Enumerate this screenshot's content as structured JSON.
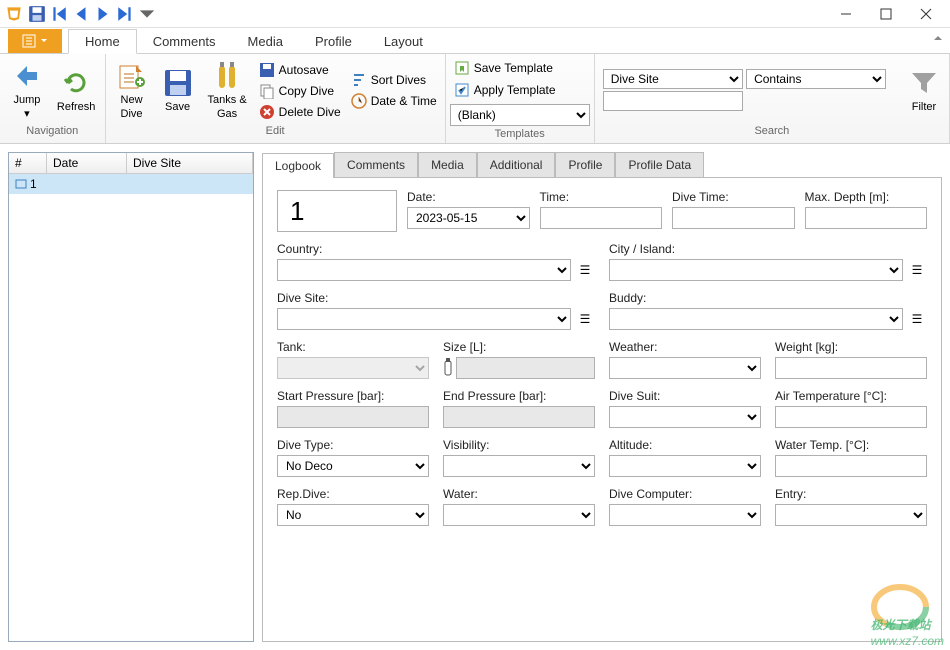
{
  "qat": {
    "save": "💾"
  },
  "menu_tabs": [
    "Home",
    "Comments",
    "Media",
    "Profile",
    "Layout"
  ],
  "active_menu_tab": "Home",
  "ribbon": {
    "navigation": {
      "label": "Navigation",
      "jump": "Jump",
      "refresh": "Refresh"
    },
    "newdive": "New\nDive",
    "save": "Save",
    "tanksgas": "Tanks &\nGas",
    "edit": {
      "label": "Edit",
      "autosave": "Autosave",
      "copydive": "Copy Dive",
      "deletedive": "Delete Dive",
      "sortdives": "Sort Dives",
      "datetime": "Date & Time"
    },
    "templates": {
      "label": "Templates",
      "save": "Save Template",
      "apply": "Apply Template",
      "selected": "(Blank)"
    },
    "search": {
      "label": "Search",
      "field": "Dive Site",
      "op": "Contains",
      "filter": "Filter"
    }
  },
  "grid": {
    "cols": {
      "num": "#",
      "date": "Date",
      "site": "Dive Site"
    },
    "rows": [
      {
        "num": "1",
        "date": "",
        "site": ""
      }
    ]
  },
  "form_tabs": [
    "Logbook",
    "Comments",
    "Media",
    "Additional",
    "Profile",
    "Profile Data"
  ],
  "active_form_tab": "Logbook",
  "logbook": {
    "number": "1",
    "date_label": "Date:",
    "date": "2023-05-15",
    "time_label": "Time:",
    "time": "",
    "divetime_label": "Dive Time:",
    "divetime": "",
    "maxdepth_label": "Max. Depth [m]:",
    "maxdepth": "",
    "country_label": "Country:",
    "country": "",
    "city_label": "City / Island:",
    "city": "",
    "divesite_label": "Dive Site:",
    "divesite": "",
    "buddy_label": "Buddy:",
    "buddy": "",
    "tank_label": "Tank:",
    "tank": "",
    "size_label": "Size [L]:",
    "size": "",
    "weather_label": "Weather:",
    "weather": "",
    "weight_label": "Weight [kg]:",
    "weight": "",
    "startpressure_label": "Start Pressure [bar]:",
    "startpressure": "",
    "endpressure_label": "End Pressure [bar]:",
    "endpressure": "",
    "divesuit_label": "Dive Suit:",
    "divesuit": "",
    "airtemp_label": "Air Temperature [°C]:",
    "airtemp": "",
    "divetype_label": "Dive Type:",
    "divetype": "No Deco",
    "visibility_label": "Visibility:",
    "visibility": "",
    "altitude_label": "Altitude:",
    "altitude": "",
    "watertemp_label": "Water Temp. [°C]:",
    "watertemp": "",
    "repdive_label": "Rep.Dive:",
    "repdive": "No",
    "water_label": "Water:",
    "water": "",
    "divecomputer_label": "Dive Computer:",
    "divecomputer": "",
    "entry_label": "Entry:",
    "entry": ""
  },
  "watermark": {
    "site": "www.xz7.com",
    "name": "极光下载站"
  }
}
